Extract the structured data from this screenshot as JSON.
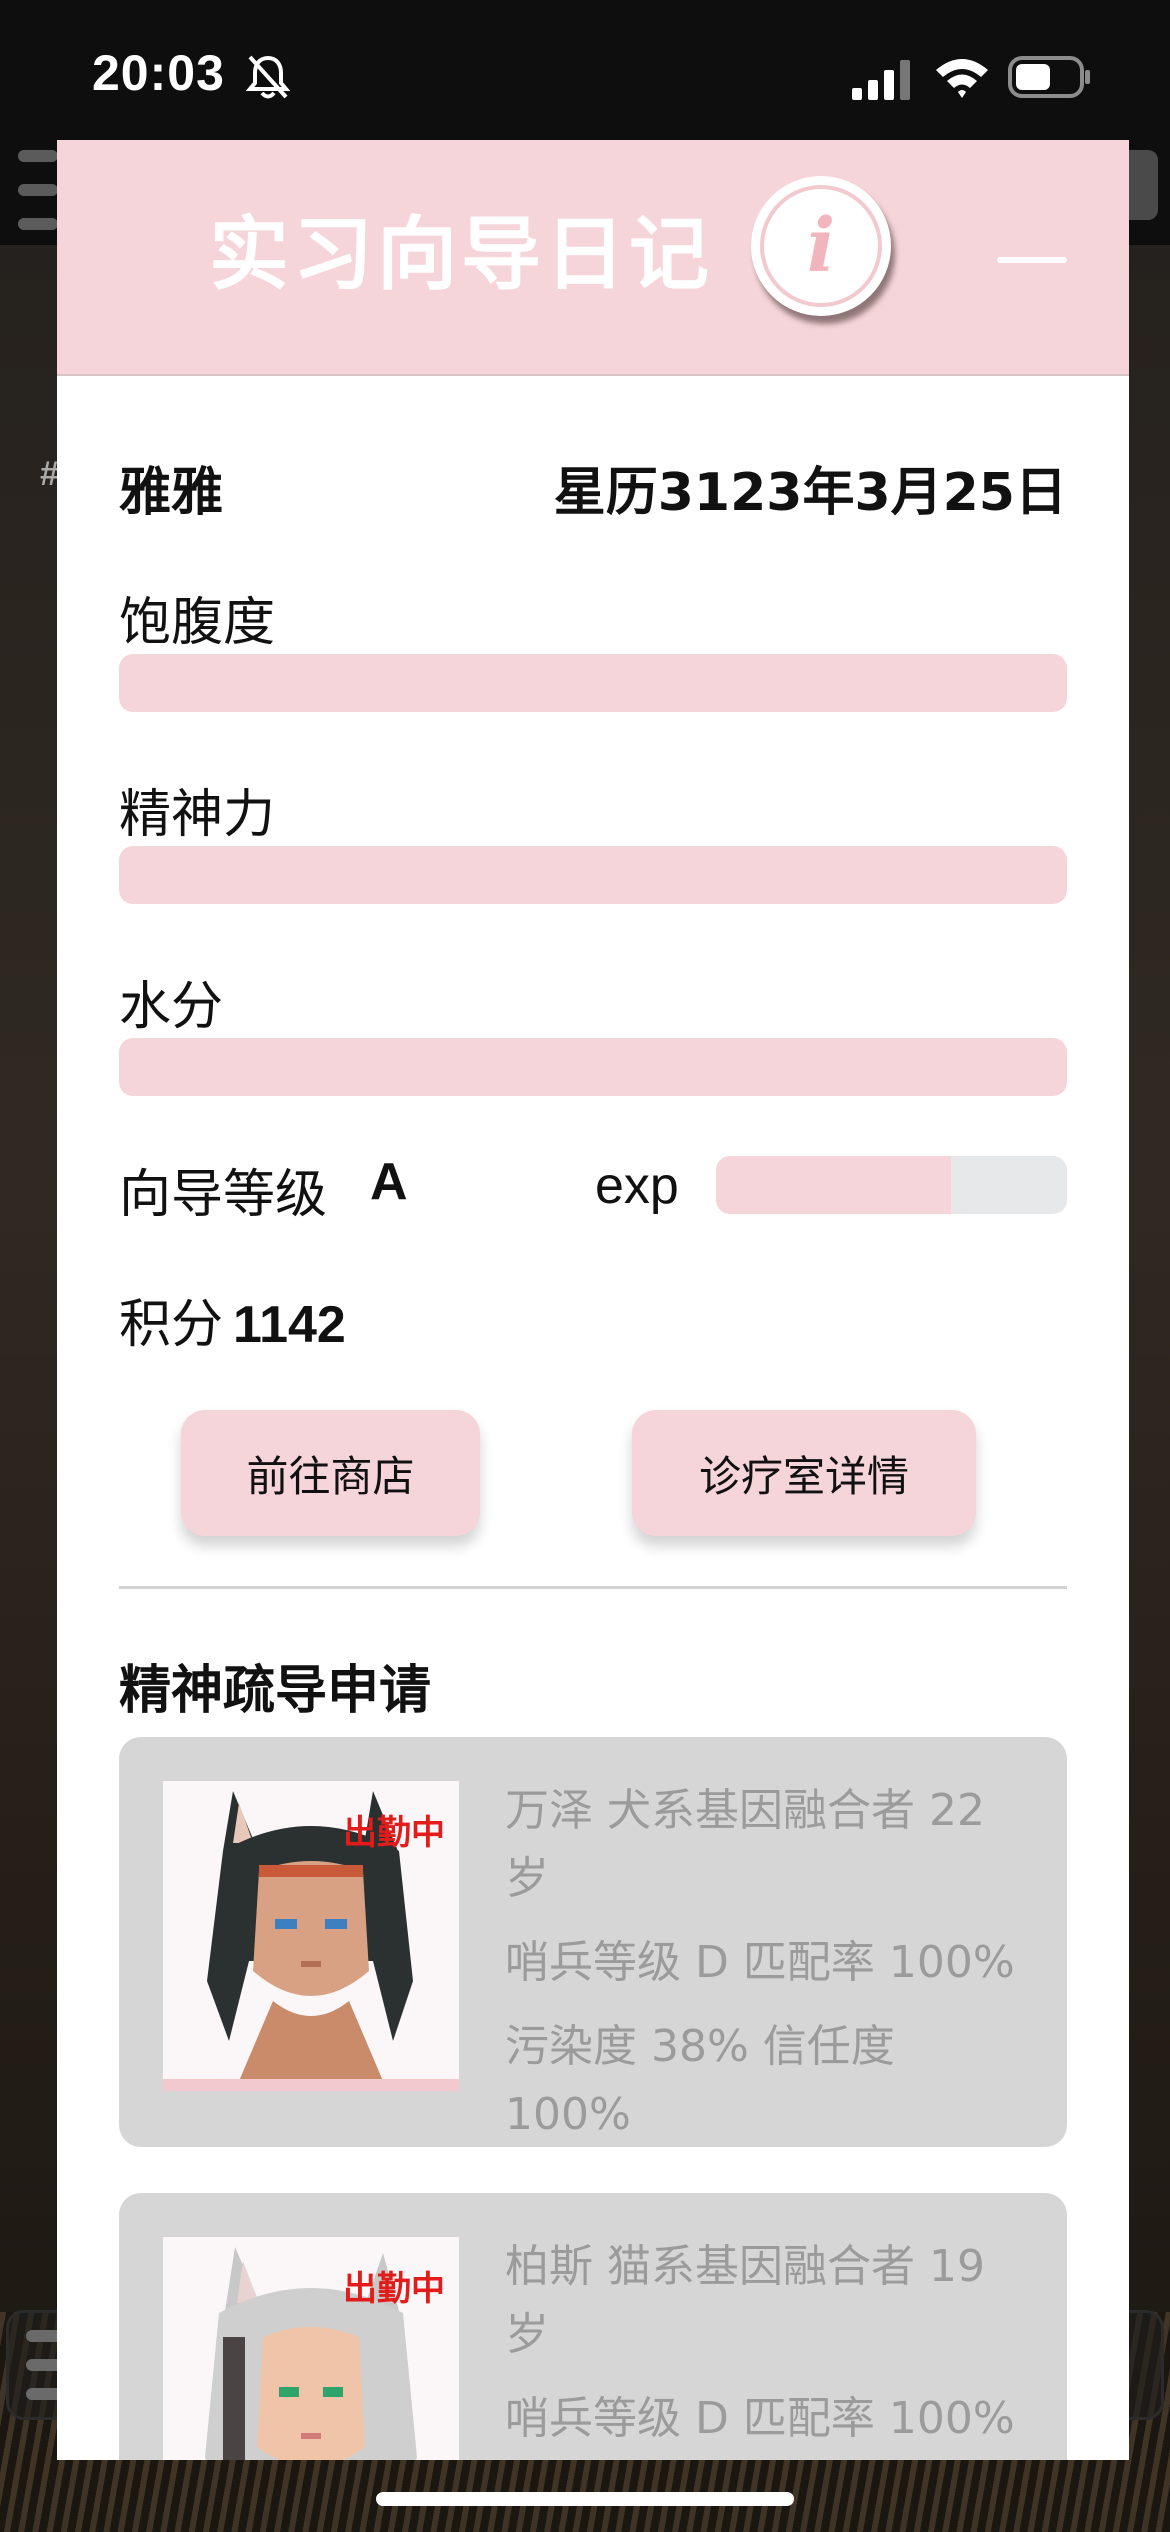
{
  "status_bar": {
    "time": "20:03"
  },
  "modal": {
    "title": "实习向导日记",
    "name": "雅雅",
    "date": "星历3123年3月25日",
    "stats": [
      {
        "label": "饱腹度",
        "value": 1.0
      },
      {
        "label": "精神力",
        "value": 1.0
      },
      {
        "label": "水分",
        "value": 1.0
      }
    ],
    "level_label": "向导等级",
    "level_value": "A",
    "exp_label": "exp",
    "exp_fraction": 0.67,
    "points_label": "积分",
    "points_value": "1142",
    "shop_button": "前往商店",
    "clinic_button": "诊疗室详情",
    "section_title": "精神疏导申请",
    "sentinels": [
      {
        "badge": "出勤中",
        "line1": "万泽 犬系基因融合者 22岁",
        "line2": "哨兵等级 D 匹配率 100%",
        "line3": "污染度 38% 信任度 100%"
      },
      {
        "badge": "出勤中",
        "line1": "柏斯 猫系基因融合者 19岁",
        "line2": "哨兵等级 D 匹配率 100%",
        "line3": ""
      }
    ]
  },
  "colors": {
    "accent_pink": "#f5d5d9",
    "badge_red": "#e21b1b",
    "card_gray": "#d6d6d6"
  }
}
